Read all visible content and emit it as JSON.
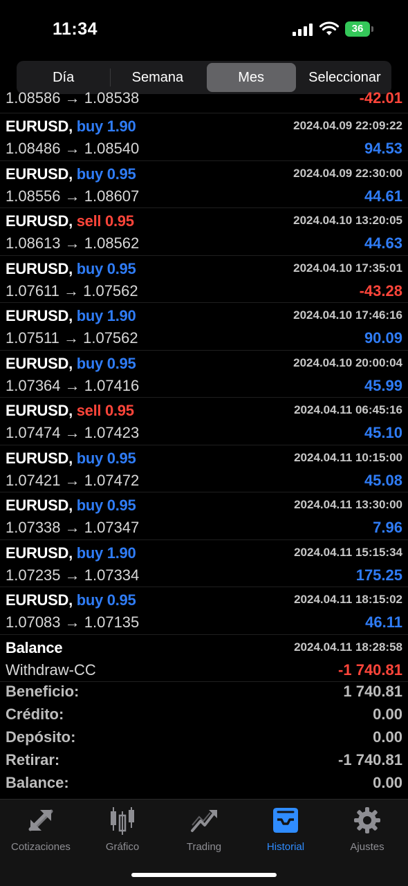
{
  "status": {
    "time": "11:34",
    "battery": "36"
  },
  "segments": [
    "Día",
    "Semana",
    "Mes",
    "Seleccionar"
  ],
  "partial_row": {
    "prices": "1.08586 → 1.08538",
    "profit": "-42.01"
  },
  "trades": [
    {
      "symbol": "EURUSD,",
      "side": "buy",
      "lot": "1.90",
      "time": "2024.04.09 22:09:22",
      "prices": "1.08486 → 1.08540",
      "profit": "94.53"
    },
    {
      "symbol": "EURUSD,",
      "side": "buy",
      "lot": "0.95",
      "time": "2024.04.09 22:30:00",
      "prices": "1.08556 → 1.08607",
      "profit": "44.61"
    },
    {
      "symbol": "EURUSD,",
      "side": "sell",
      "lot": "0.95",
      "time": "2024.04.10 13:20:05",
      "prices": "1.08613 → 1.08562",
      "profit": "44.63"
    },
    {
      "symbol": "EURUSD,",
      "side": "buy",
      "lot": "0.95",
      "time": "2024.04.10 17:35:01",
      "prices": "1.07611 → 1.07562",
      "profit": "-43.28"
    },
    {
      "symbol": "EURUSD,",
      "side": "buy",
      "lot": "1.90",
      "time": "2024.04.10 17:46:16",
      "prices": "1.07511 → 1.07562",
      "profit": "90.09"
    },
    {
      "symbol": "EURUSD,",
      "side": "buy",
      "lot": "0.95",
      "time": "2024.04.10 20:00:04",
      "prices": "1.07364 → 1.07416",
      "profit": "45.99"
    },
    {
      "symbol": "EURUSD,",
      "side": "sell",
      "lot": "0.95",
      "time": "2024.04.11 06:45:16",
      "prices": "1.07474 → 1.07423",
      "profit": "45.10"
    },
    {
      "symbol": "EURUSD,",
      "side": "buy",
      "lot": "0.95",
      "time": "2024.04.11 10:15:00",
      "prices": "1.07421 → 1.07472",
      "profit": "45.08"
    },
    {
      "symbol": "EURUSD,",
      "side": "buy",
      "lot": "0.95",
      "time": "2024.04.11 13:30:00",
      "prices": "1.07338 → 1.07347",
      "profit": "7.96"
    },
    {
      "symbol": "EURUSD,",
      "side": "buy",
      "lot": "1.90",
      "time": "2024.04.11 15:15:34",
      "prices": "1.07235 → 1.07334",
      "profit": "175.25"
    },
    {
      "symbol": "EURUSD,",
      "side": "buy",
      "lot": "0.95",
      "time": "2024.04.11 18:15:02",
      "prices": "1.07083 → 1.07135",
      "profit": "46.11"
    }
  ],
  "balance_row": {
    "title": "Balance",
    "time": "2024.04.11 18:28:58",
    "desc": "Withdraw-CC",
    "amount": "-1 740.81"
  },
  "summary": [
    {
      "label": "Beneficio:",
      "value": "1 740.81"
    },
    {
      "label": "Crédito:",
      "value": "0.00"
    },
    {
      "label": "Depósito:",
      "value": "0.00"
    },
    {
      "label": "Retirar:",
      "value": "-1 740.81"
    },
    {
      "label": "Balance:",
      "value": "0.00"
    }
  ],
  "tabs": [
    {
      "label": "Cotizaciones",
      "icon": "quotes-arrows-icon"
    },
    {
      "label": "Gráfico",
      "icon": "candlestick-chart-icon"
    },
    {
      "label": "Trading",
      "icon": "trading-chart-icon"
    },
    {
      "label": "Historial",
      "icon": "history-inbox-icon",
      "active": true
    },
    {
      "label": "Ajustes",
      "icon": "gear-icon"
    }
  ],
  "colors": {
    "buy": "#2f7cf6",
    "sell": "#ff453a",
    "active_tab": "#2f8cff",
    "battery": "#34c759"
  }
}
